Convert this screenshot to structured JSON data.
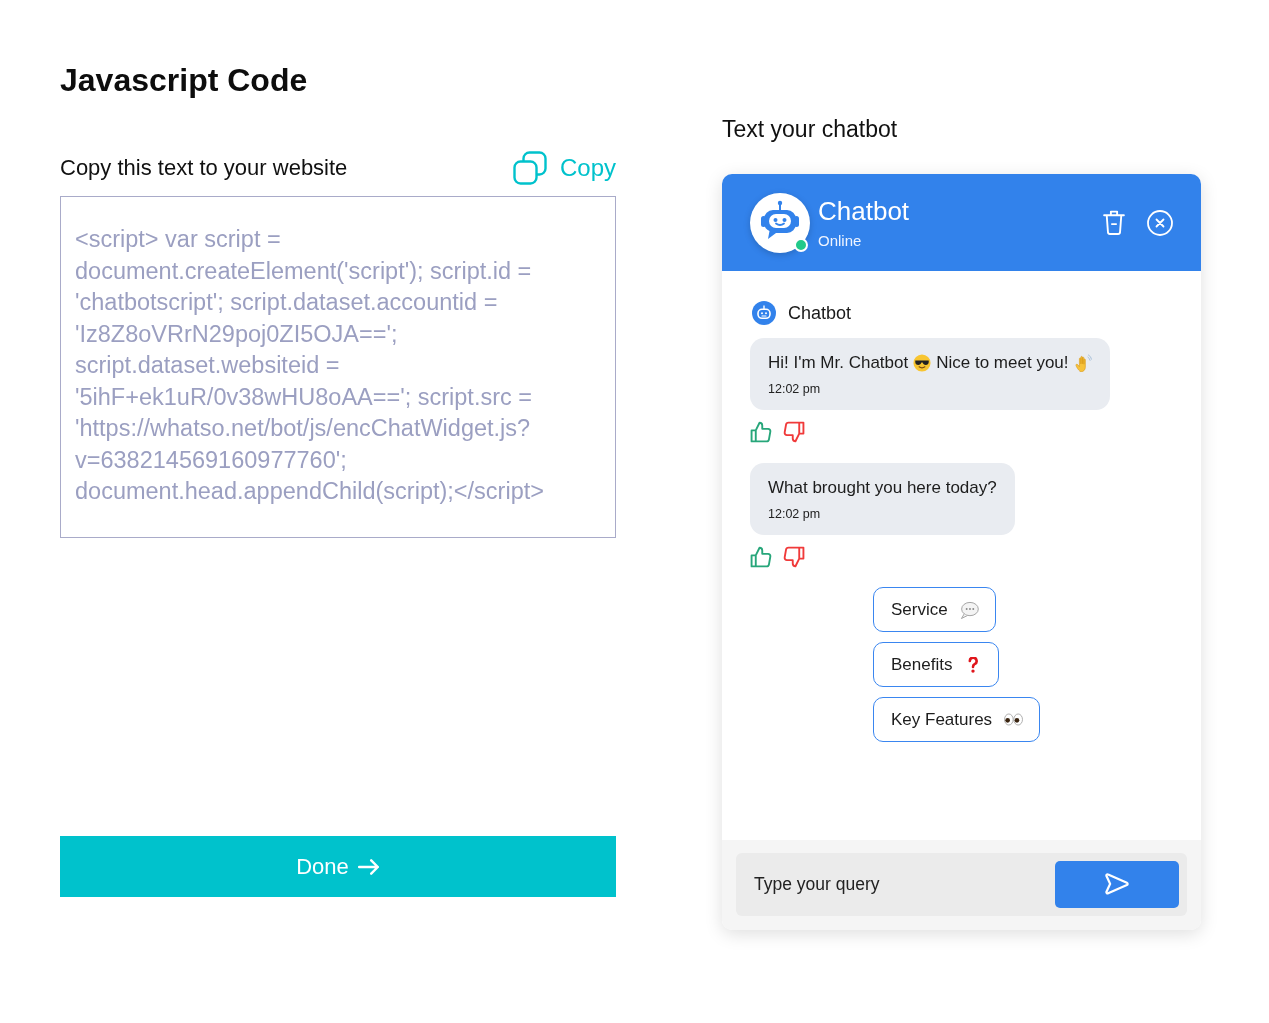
{
  "page": {
    "title": "Javascript Code"
  },
  "code_panel": {
    "label": "Copy this text to your website",
    "copy_button": "Copy",
    "code": "<script> var script = document.createElement('script'); script.id = 'chatbotscript'; script.dataset.accountid = 'Iz8Z8oVRrN29poj0ZI5OJA=='; script.dataset.websiteid = '5ihF+ek1uR/0v38wHU8oAA=='; script.src = 'https://whatso.net/bot/js/encChatWidget.js?v=638214569160977760'; document.head.appendChild(script);</script>",
    "done_button": "Done"
  },
  "chat_preview": {
    "label": "Text your chatbot",
    "header": {
      "name": "Chatbot",
      "status": "Online"
    },
    "bot_label": "Chatbot",
    "messages": [
      {
        "segments": [
          {
            "kind": "text",
            "text": "Hi! I'm Mr. Chatbot"
          },
          {
            "kind": "cool"
          },
          {
            "kind": "text",
            "text": "Nice to meet you!"
          },
          {
            "kind": "wave"
          }
        ],
        "time": "12:02 pm"
      },
      {
        "segments": [
          {
            "kind": "text",
            "text": "What brought you here today?"
          }
        ],
        "time": "12:02 pm"
      }
    ],
    "options": [
      {
        "label": "Service",
        "kind": "speech"
      },
      {
        "label": "Benefits",
        "kind": "question"
      },
      {
        "label": "Key Features",
        "kind": "eyes"
      }
    ],
    "input": {
      "placeholder": "Type your query"
    }
  }
}
